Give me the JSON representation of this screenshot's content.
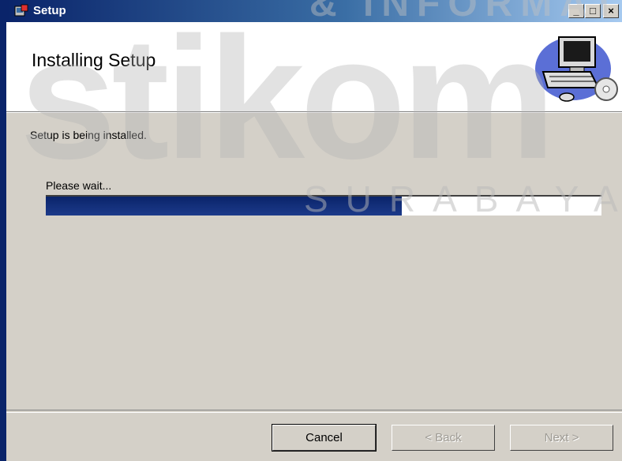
{
  "window": {
    "title": "Setup"
  },
  "header": {
    "title": "Installing Setup"
  },
  "content": {
    "status": "Setup is being installed.",
    "wait_label": "Please wait...",
    "progress_percent": 64
  },
  "buttons": {
    "cancel": "Cancel",
    "back": "< Back",
    "next": "Next >"
  },
  "titlebar_buttons": {
    "minimize": "_",
    "maximize": "□",
    "close": "×"
  },
  "watermark": {
    "logo": "stikom",
    "top": "& INFORMATIKA",
    "bottom": "SURABAYA"
  }
}
